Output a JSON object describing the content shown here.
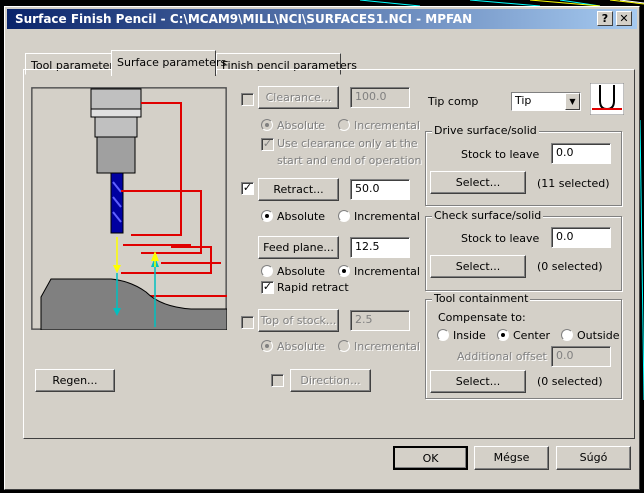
{
  "window": {
    "title": "Surface Finish Pencil - C:\\MCAM9\\MILL\\NCI\\SURFACES1.NCI - MPFAN",
    "help_glyph": "?",
    "close_glyph": "✕"
  },
  "tabs": [
    {
      "label": "Tool parameters",
      "active": false
    },
    {
      "label": "Surface parameters",
      "active": true
    },
    {
      "label": "Finish pencil parameters",
      "active": false
    }
  ],
  "clearance": {
    "button": "Clearance...",
    "value": "100.0",
    "checked": false,
    "enabled": false
  },
  "clearance_mode": {
    "absolute": "Absolute",
    "incremental": "Incremental",
    "selected": "absolute"
  },
  "clearance_option": {
    "label_line1": "Use clearance only at the",
    "label_line2": "start and end of operation",
    "checked": true
  },
  "retract": {
    "button": "Retract...",
    "value": "50.0",
    "checked": true
  },
  "retract_mode": {
    "absolute": "Absolute",
    "incremental": "Incremental",
    "selected": "absolute"
  },
  "feed_plane": {
    "button": "Feed plane...",
    "value": "12.5"
  },
  "feed_mode": {
    "absolute": "Absolute",
    "incremental": "Incremental",
    "selected": "incremental"
  },
  "rapid_retract": {
    "label": "Rapid retract",
    "checked": true
  },
  "top_of_stock": {
    "button": "Top of stock...",
    "value": "2.5",
    "checked": false
  },
  "top_mode": {
    "absolute": "Absolute",
    "incremental": "Incremental",
    "selected": "absolute"
  },
  "direction": {
    "button": "Direction...",
    "checked": false
  },
  "regen": {
    "button": "Regen..."
  },
  "tip_comp": {
    "label": "Tip comp",
    "value": "Tip"
  },
  "drive_group": {
    "title": "Drive surface/solid",
    "stock_label": "Stock to leave",
    "stock_value": "0.0",
    "select_button": "Select...",
    "selected_text": "(11  selected)"
  },
  "check_group": {
    "title": "Check surface/solid",
    "stock_label": "Stock to leave",
    "stock_value": "0.0",
    "select_button": "Select...",
    "selected_text": "(0  selected)"
  },
  "containment_group": {
    "title": "Tool containment",
    "compensate_label": "Compensate to:",
    "inside": "Inside",
    "center": "Center",
    "outside": "Outside",
    "selected": "center",
    "offset_label": "Additional offset",
    "offset_value": "0.0",
    "select_button": "Select...",
    "selected_text": "(0  selected)"
  },
  "footer": {
    "ok": "OK",
    "cancel": "Mégse",
    "help": "Súgó"
  },
  "colors": {
    "title_start": "#0a246a",
    "title_end": "#a6caf0",
    "dialog_bg": "#d4d0c8",
    "guide_line": "#e00000",
    "tool_shank": "#0000a0",
    "arrow_yellow": "#ffff00",
    "arrow_cyan": "#00c0c0"
  }
}
